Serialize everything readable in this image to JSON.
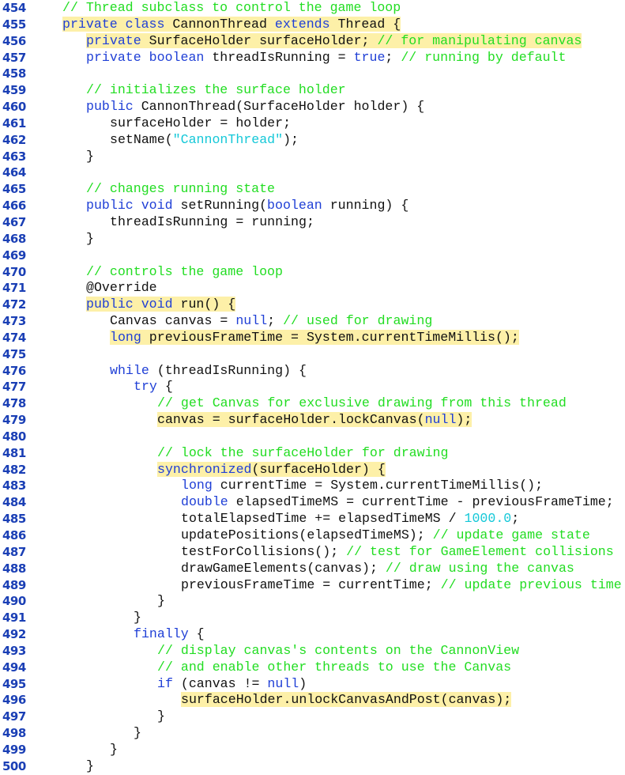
{
  "listing": {
    "colors": {
      "line_number": "#1a3fb5",
      "keyword": "#1f3fd6",
      "comment": "#22dd22",
      "literal": "#15c8d8",
      "plain": "#111111",
      "highlight": "#fdf0a8"
    },
    "lines": [
      {
        "n": "454",
        "indent": 0,
        "hl": false,
        "tokens": [
          [
            "cm",
            "// Thread subclass to control the game loop"
          ]
        ]
      },
      {
        "n": "455",
        "indent": 0,
        "hl": true,
        "tokens": [
          [
            "kw",
            "private class "
          ],
          [
            "pl",
            "CannonThread "
          ],
          [
            "kw",
            "extends "
          ],
          [
            "pl",
            "Thread {"
          ]
        ]
      },
      {
        "n": "456",
        "indent": 1,
        "hl": true,
        "tokens": [
          [
            "kw",
            "private "
          ],
          [
            "pl",
            "SurfaceHolder surfaceHolder; "
          ],
          [
            "cm",
            "// for manipulating canvas"
          ]
        ]
      },
      {
        "n": "457",
        "indent": 1,
        "hl": false,
        "tokens": [
          [
            "kw",
            "private boolean "
          ],
          [
            "pl",
            "threadIsRunning = "
          ],
          [
            "kw",
            "true"
          ],
          [
            "pl",
            "; "
          ],
          [
            "cm",
            "// running by default"
          ]
        ]
      },
      {
        "n": "458",
        "indent": 0,
        "hl": false,
        "tokens": []
      },
      {
        "n": "459",
        "indent": 1,
        "hl": false,
        "tokens": [
          [
            "cm",
            "// initializes the surface holder"
          ]
        ]
      },
      {
        "n": "460",
        "indent": 1,
        "hl": false,
        "tokens": [
          [
            "kw",
            "public "
          ],
          [
            "pl",
            "CannonThread(SurfaceHolder holder) {"
          ]
        ]
      },
      {
        "n": "461",
        "indent": 2,
        "hl": false,
        "tokens": [
          [
            "pl",
            "surfaceHolder = holder;"
          ]
        ]
      },
      {
        "n": "462",
        "indent": 2,
        "hl": false,
        "tokens": [
          [
            "pl",
            "setName("
          ],
          [
            "str",
            "\"CannonThread\""
          ],
          [
            "pl",
            ");"
          ]
        ]
      },
      {
        "n": "463",
        "indent": 1,
        "hl": false,
        "tokens": [
          [
            "pl",
            "}"
          ]
        ]
      },
      {
        "n": "464",
        "indent": 0,
        "hl": false,
        "tokens": []
      },
      {
        "n": "465",
        "indent": 1,
        "hl": false,
        "tokens": [
          [
            "cm",
            "// changes running state"
          ]
        ]
      },
      {
        "n": "466",
        "indent": 1,
        "hl": false,
        "tokens": [
          [
            "kw",
            "public void "
          ],
          [
            "pl",
            "setRunning("
          ],
          [
            "kw",
            "boolean "
          ],
          [
            "pl",
            "running) {"
          ]
        ]
      },
      {
        "n": "467",
        "indent": 2,
        "hl": false,
        "tokens": [
          [
            "pl",
            "threadIsRunning = running;"
          ]
        ]
      },
      {
        "n": "468",
        "indent": 1,
        "hl": false,
        "tokens": [
          [
            "pl",
            "}"
          ]
        ]
      },
      {
        "n": "469",
        "indent": 0,
        "hl": false,
        "tokens": []
      },
      {
        "n": "470",
        "indent": 1,
        "hl": false,
        "tokens": [
          [
            "cm",
            "// controls the game loop"
          ]
        ]
      },
      {
        "n": "471",
        "indent": 1,
        "hl": false,
        "tokens": [
          [
            "pl",
            "@Override"
          ]
        ]
      },
      {
        "n": "472",
        "indent": 1,
        "hl": true,
        "tokens": [
          [
            "kw",
            "public void "
          ],
          [
            "pl",
            "run() {"
          ]
        ]
      },
      {
        "n": "473",
        "indent": 2,
        "hl": false,
        "tokens": [
          [
            "pl",
            "Canvas canvas = "
          ],
          [
            "kw",
            "null"
          ],
          [
            "pl",
            "; "
          ],
          [
            "cm",
            "// used for drawing"
          ]
        ]
      },
      {
        "n": "474",
        "indent": 2,
        "hl": true,
        "tokens": [
          [
            "kw",
            "long "
          ],
          [
            "pl",
            "previousFrameTime = System.currentTimeMillis();"
          ]
        ]
      },
      {
        "n": "475",
        "indent": 0,
        "hl": false,
        "tokens": []
      },
      {
        "n": "476",
        "indent": 2,
        "hl": false,
        "tokens": [
          [
            "kw",
            "while "
          ],
          [
            "pl",
            "(threadIsRunning) {"
          ]
        ]
      },
      {
        "n": "477",
        "indent": 3,
        "hl": false,
        "tokens": [
          [
            "kw",
            "try "
          ],
          [
            "pl",
            "{"
          ]
        ]
      },
      {
        "n": "478",
        "indent": 4,
        "hl": false,
        "tokens": [
          [
            "cm",
            "// get Canvas for exclusive drawing from this thread"
          ]
        ]
      },
      {
        "n": "479",
        "indent": 4,
        "hl": true,
        "tokens": [
          [
            "pl",
            "canvas = surfaceHolder.lockCanvas("
          ],
          [
            "kw",
            "null"
          ],
          [
            "pl",
            ");"
          ]
        ]
      },
      {
        "n": "480",
        "indent": 0,
        "hl": false,
        "tokens": []
      },
      {
        "n": "481",
        "indent": 4,
        "hl": false,
        "tokens": [
          [
            "cm",
            "// lock the surfaceHolder for drawing"
          ]
        ]
      },
      {
        "n": "482",
        "indent": 4,
        "hl": true,
        "tokens": [
          [
            "kw",
            "synchronized"
          ],
          [
            "pl",
            "(surfaceHolder) {"
          ]
        ]
      },
      {
        "n": "483",
        "indent": 5,
        "hl": false,
        "tokens": [
          [
            "kw",
            "long "
          ],
          [
            "pl",
            "currentTime = System.currentTimeMillis();"
          ]
        ]
      },
      {
        "n": "484",
        "indent": 5,
        "hl": false,
        "tokens": [
          [
            "kw",
            "double "
          ],
          [
            "pl",
            "elapsedTimeMS = currentTime - previousFrameTime;"
          ]
        ]
      },
      {
        "n": "485",
        "indent": 5,
        "hl": false,
        "tokens": [
          [
            "pl",
            "totalElapsedTime += elapsedTimeMS / "
          ],
          [
            "num",
            "1000.0"
          ],
          [
            "pl",
            ";"
          ]
        ]
      },
      {
        "n": "486",
        "indent": 5,
        "hl": false,
        "tokens": [
          [
            "pl",
            "updatePositions(elapsedTimeMS); "
          ],
          [
            "cm",
            "// update game state"
          ]
        ]
      },
      {
        "n": "487",
        "indent": 5,
        "hl": false,
        "tokens": [
          [
            "pl",
            "testForCollisions(); "
          ],
          [
            "cm",
            "// test for GameElement collisions"
          ]
        ]
      },
      {
        "n": "488",
        "indent": 5,
        "hl": false,
        "tokens": [
          [
            "pl",
            "drawGameElements(canvas); "
          ],
          [
            "cm",
            "// draw using the canvas"
          ]
        ]
      },
      {
        "n": "489",
        "indent": 5,
        "hl": false,
        "tokens": [
          [
            "pl",
            "previousFrameTime = currentTime; "
          ],
          [
            "cm",
            "// update previous time"
          ]
        ]
      },
      {
        "n": "490",
        "indent": 4,
        "hl": false,
        "tokens": [
          [
            "pl",
            "}"
          ]
        ]
      },
      {
        "n": "491",
        "indent": 3,
        "hl": false,
        "tokens": [
          [
            "pl",
            "}"
          ]
        ]
      },
      {
        "n": "492",
        "indent": 3,
        "hl": false,
        "tokens": [
          [
            "kw",
            "finally "
          ],
          [
            "pl",
            "{"
          ]
        ]
      },
      {
        "n": "493",
        "indent": 4,
        "hl": false,
        "tokens": [
          [
            "cm",
            "// display canvas's contents on the CannonView"
          ]
        ]
      },
      {
        "n": "494",
        "indent": 4,
        "hl": false,
        "tokens": [
          [
            "cm",
            "// and enable other threads to use the Canvas"
          ]
        ]
      },
      {
        "n": "495",
        "indent": 4,
        "hl": false,
        "tokens": [
          [
            "kw",
            "if "
          ],
          [
            "pl",
            "(canvas != "
          ],
          [
            "kw",
            "null"
          ],
          [
            "pl",
            ")"
          ]
        ]
      },
      {
        "n": "496",
        "indent": 5,
        "hl": true,
        "tokens": [
          [
            "pl",
            "surfaceHolder.unlockCanvasAndPost(canvas);"
          ]
        ]
      },
      {
        "n": "497",
        "indent": 4,
        "hl": false,
        "tokens": [
          [
            "pl",
            "}"
          ]
        ]
      },
      {
        "n": "498",
        "indent": 3,
        "hl": false,
        "tokens": [
          [
            "pl",
            "}"
          ]
        ]
      },
      {
        "n": "499",
        "indent": 2,
        "hl": false,
        "tokens": [
          [
            "pl",
            "}"
          ]
        ]
      },
      {
        "n": "500",
        "indent": 1,
        "hl": false,
        "tokens": [
          [
            "pl",
            "}"
          ]
        ]
      }
    ]
  }
}
